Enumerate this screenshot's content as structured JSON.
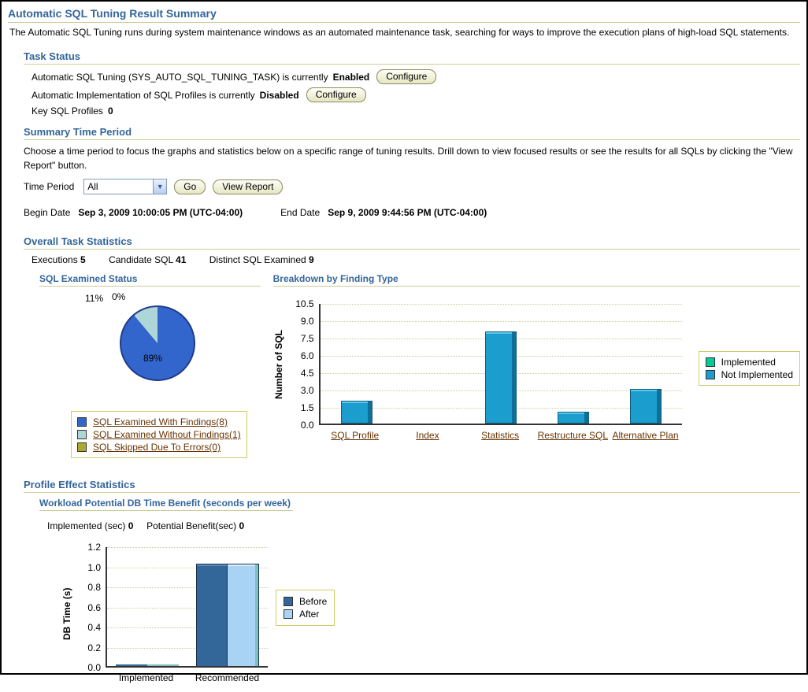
{
  "page": {
    "title": "Automatic SQL Tuning Result Summary",
    "intro": "The Automatic SQL Tuning runs during system maintenance windows as an automated maintenance task, searching for ways to improve the execution plans of high-load SQL statements."
  },
  "colors": {
    "heading_blue": "#336699",
    "rule_tan": "#CCCC99",
    "link_brown": "#663300"
  },
  "task_status": {
    "heading": "Task Status",
    "line1_prefix": "Automatic SQL Tuning (SYS_AUTO_SQL_TUNING_TASK) is currently",
    "line1_status": "Enabled",
    "line1_button": "Configure",
    "line2_prefix": "Automatic Implementation of SQL Profiles is currently",
    "line2_status": "Disabled",
    "line2_button": "Configure",
    "line3_label": "Key SQL Profiles",
    "line3_value": "0"
  },
  "time_period": {
    "heading": "Summary Time Period",
    "description": "Choose a time period to focus the graphs and statistics below on a specific range of tuning results. Drill down to view focused results or see the results for all SQLs by clicking the \"View Report\" button.",
    "label": "Time Period",
    "selected": "All",
    "go_button": "Go",
    "view_report_button": "View Report",
    "begin_label": "Begin Date",
    "begin_value": "Sep 3, 2009 10:00:05 PM (UTC-04:00)",
    "end_label": "End Date",
    "end_value": "Sep 9, 2009 9:44:56 PM (UTC-04:00)"
  },
  "overall": {
    "heading": "Overall Task Statistics",
    "stats": [
      {
        "label": "Executions",
        "value": "5"
      },
      {
        "label": "Candidate SQL",
        "value": "41"
      },
      {
        "label": "Distinct SQL Examined",
        "value": "9"
      }
    ],
    "pie_heading": "SQL Examined Status",
    "bar_heading": "Breakdown by Finding Type"
  },
  "profile_effect": {
    "heading": "Profile Effect Statistics",
    "sub_heading": "Workload Potential DB Time Benefit (seconds per week)",
    "implemented_label": "Implemented (sec)",
    "implemented_value": "0",
    "potential_label": "Potential Benefit(sec)",
    "potential_value": "0"
  },
  "chart_data": [
    {
      "type": "pie",
      "title": "SQL Examined Status",
      "labels": [
        "SQL Examined With Findings(8)",
        "SQL Examined Without Findings(1)",
        "SQL Skipped Due To Errors(0)"
      ],
      "values": [
        8,
        1,
        0
      ],
      "percent_labels": [
        "89%",
        "11%",
        "0%"
      ],
      "colors": [
        "#3366CC",
        "#AFD6D6",
        "#AAAA33"
      ],
      "legend_position": "bottom"
    },
    {
      "type": "bar",
      "title": "Breakdown by Finding Type",
      "xlabel": "",
      "ylabel": "Number of SQL",
      "categories": [
        "SQL Profile",
        "Index",
        "Statistics",
        "Restructure SQL",
        "Alternative Plan"
      ],
      "series": [
        {
          "name": "Implemented",
          "color": "#00CC99",
          "values": [
            0,
            0,
            0,
            0,
            0
          ]
        },
        {
          "name": "Not Implemented",
          "color": "#1B9DCE",
          "values": [
            2,
            0,
            8,
            1,
            3
          ]
        }
      ],
      "ylim": [
        0,
        10.5
      ],
      "yticks": [
        "10.5",
        "9.0",
        "7.5",
        "6.0",
        "4.5",
        "3.0",
        "1.5",
        "0.0"
      ],
      "grid": "dotted",
      "legend_position": "right"
    },
    {
      "type": "bar",
      "title": "Workload Potential DB Time Benefit (seconds per week)",
      "xlabel": "",
      "ylabel": "DB Time (s)",
      "categories": [
        "Implemented",
        "Recommended"
      ],
      "series": [
        {
          "name": "Before",
          "color": "#336699",
          "values": [
            0.01,
            1.02
          ]
        },
        {
          "name": "After",
          "color": "#A9D3F5",
          "values": [
            0.01,
            1.02
          ]
        }
      ],
      "ylim": [
        0,
        1.2
      ],
      "yticks": [
        "1.2",
        "1.0",
        "0.8",
        "0.6",
        "0.4",
        "0.2",
        "0.0"
      ],
      "grid": "dotted",
      "legend_position": "right"
    }
  ]
}
